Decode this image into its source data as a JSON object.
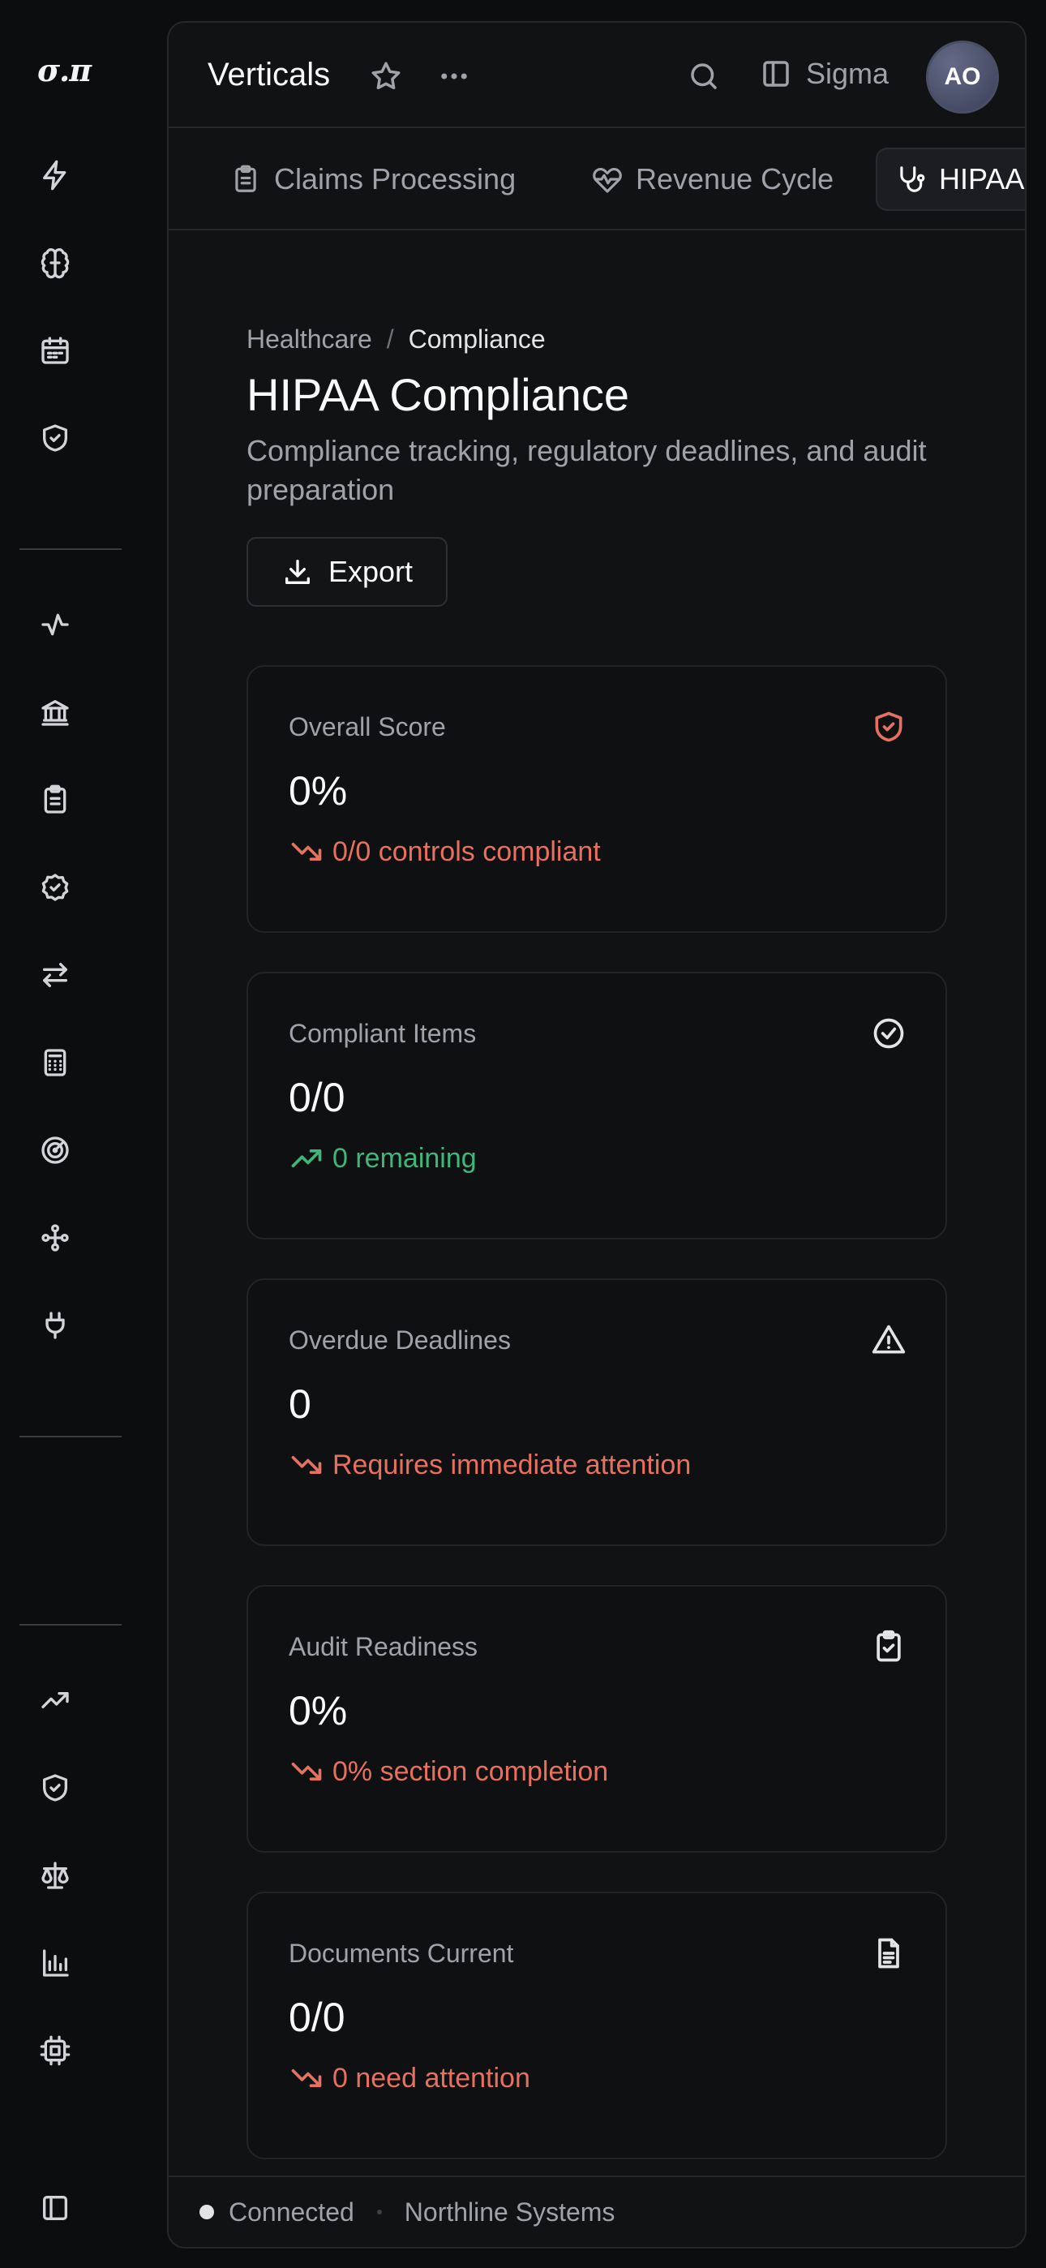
{
  "app": {
    "logo": "σ.π",
    "title": "Verticals"
  },
  "header": {
    "sigma_label": "Sigma",
    "avatar_initials": "AO"
  },
  "tabs": [
    {
      "label": "Claims Processing",
      "icon": "clipboard-icon"
    },
    {
      "label": "Revenue Cycle",
      "icon": "heart-pulse-icon"
    },
    {
      "label": "HIPAA",
      "icon": "stethoscope-icon",
      "active": true
    }
  ],
  "breadcrumb": {
    "parent": "Healthcare",
    "separator": "/",
    "current": "Compliance"
  },
  "page": {
    "title": "HIPAA Compliance",
    "description": "Compliance tracking, regulatory deadlines, and audit preparation",
    "export_label": "Export"
  },
  "cards": [
    {
      "label": "Overall Score",
      "value": "0%",
      "trend_text": "0/0 controls compliant",
      "trend": "down",
      "icon": "shield-icon"
    },
    {
      "label": "Compliant Items",
      "value": "0/0",
      "trend_text": "0 remaining",
      "trend": "up",
      "icon": "check-circle-icon"
    },
    {
      "label": "Overdue Deadlines",
      "value": "0",
      "trend_text": "Requires immediate attention",
      "trend": "down",
      "icon": "alert-triangle-icon"
    },
    {
      "label": "Audit Readiness",
      "value": "0%",
      "trend_text": "0% section completion",
      "trend": "down",
      "icon": "clipboard-check-icon"
    },
    {
      "label": "Documents Current",
      "value": "0/0",
      "trend_text": "0 need attention",
      "trend": "down",
      "icon": "file-text-icon"
    }
  ],
  "status": {
    "connection": "Connected",
    "org": "Northline Systems"
  },
  "colors": {
    "negative": "#e8705f",
    "positive": "#3fb67b",
    "alert_icon": "#e8705f"
  }
}
